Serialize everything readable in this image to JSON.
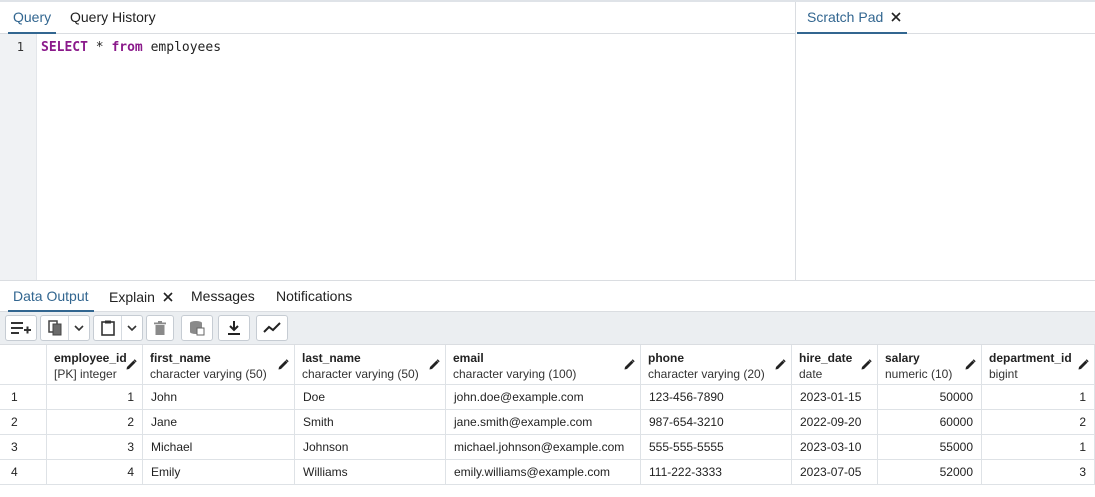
{
  "editor": {
    "tabs": [
      "Query",
      "Query History"
    ],
    "active_tab": "Query",
    "line_number": "1",
    "sql": {
      "kw1": "SELECT",
      "mid": " * ",
      "kw2": "from",
      "rest": " employees"
    }
  },
  "scratch_pad": {
    "title": "Scratch Pad",
    "close_icon": "close-icon"
  },
  "output": {
    "tabs": [
      "Data Output",
      "Explain",
      "Messages",
      "Notifications"
    ],
    "active_tab": "Data Output",
    "toolbar_icons": [
      "add-row-icon",
      "copy-icon",
      "copy-options-chevron-icon",
      "paste-icon",
      "paste-options-chevron-icon",
      "delete-icon",
      "save-data-icon",
      "download-icon",
      "graph-icon"
    ]
  },
  "grid": {
    "columns": [
      {
        "name": "employee_id",
        "type": "[PK] integer"
      },
      {
        "name": "first_name",
        "type": "character varying (50)"
      },
      {
        "name": "last_name",
        "type": "character varying (50)"
      },
      {
        "name": "email",
        "type": "character varying (100)"
      },
      {
        "name": "phone",
        "type": "character varying (20)"
      },
      {
        "name": "hire_date",
        "type": "date"
      },
      {
        "name": "salary",
        "type": "numeric (10)"
      },
      {
        "name": "department_id",
        "type": "bigint"
      }
    ],
    "rows": [
      {
        "n": "1",
        "c": [
          "1",
          "John",
          "Doe",
          "john.doe@example.com",
          "123-456-7890",
          "2023-01-15",
          "50000",
          "1"
        ]
      },
      {
        "n": "2",
        "c": [
          "2",
          "Jane",
          "Smith",
          "jane.smith@example.com",
          "987-654-3210",
          "2022-09-20",
          "60000",
          "2"
        ]
      },
      {
        "n": "3",
        "c": [
          "3",
          "Michael",
          "Johnson",
          "michael.johnson@example.com",
          "555-555-5555",
          "2023-03-10",
          "55000",
          "1"
        ]
      },
      {
        "n": "4",
        "c": [
          "4",
          "Emily",
          "Williams",
          "emily.williams@example.com",
          "111-222-3333",
          "2023-07-05",
          "52000",
          "3"
        ]
      }
    ]
  },
  "colors": {
    "accent": "#326690",
    "keyword": "#8b1a8b",
    "toolbar_bg": "#ebeef1"
  }
}
